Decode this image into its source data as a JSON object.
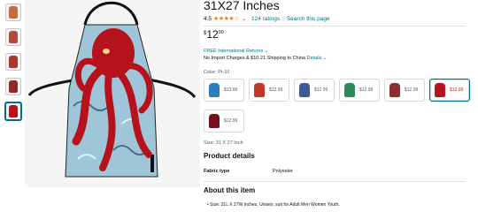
{
  "product": {
    "title": "31X27 Inches",
    "rating_value": "4.5",
    "stars": "★★★★☆",
    "ratings_link": "124 ratings",
    "search_link": "Search this page"
  },
  "price": {
    "currency": "$",
    "dollars": "12",
    "cents": "99"
  },
  "shipping": {
    "returns": "FREE International Returns",
    "import": "No Import Charges & $10.21 Shipping to China",
    "details_link": "Details"
  },
  "color": {
    "label": "Color: Pt-10",
    "options": [
      {
        "price": "$13.99",
        "accent": "#2a7fc1",
        "selected": false
      },
      {
        "price": "$12.99",
        "accent": "#c0392b",
        "selected": false
      },
      {
        "price": "$12.99",
        "accent": "#3b5b92",
        "selected": false
      },
      {
        "price": "$12.99",
        "accent": "#2e8b57",
        "selected": false
      },
      {
        "price": "$12.99",
        "accent": "#8b2e2e",
        "selected": false
      },
      {
        "price": "$12.99",
        "accent": "#b5121b",
        "selected": true
      },
      {
        "price": "$12.99",
        "accent": "#7a0f1a",
        "selected": false
      }
    ]
  },
  "size_label": "Size: 31 X 27 Inch",
  "product_details": {
    "heading": "Product details",
    "rows": [
      {
        "key": "Fabric type",
        "value": "Polyester"
      }
    ]
  },
  "about": {
    "heading": "About this item",
    "bullets": [
      "Size: 31L X 27W Inches, Unisex, suit for Adult Men Women Youth."
    ]
  },
  "colors": {
    "link": "#007185",
    "star": "#de7921",
    "octopus": "#b5121b",
    "apron_bg": "#9fc6d8"
  }
}
